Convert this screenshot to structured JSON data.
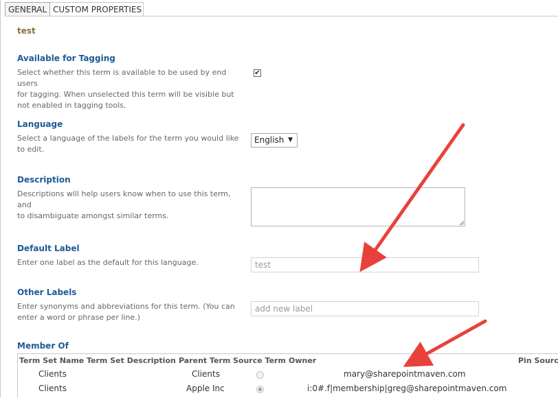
{
  "tabs": [
    {
      "label": "GENERAL"
    },
    {
      "label": "CUSTOM PROPERTIES"
    }
  ],
  "term": {
    "name": "test"
  },
  "sections": {
    "tagging": {
      "title": "Available for Tagging",
      "desc_lines": [
        "Select whether this term is available to be used by end users",
        "for tagging. When unselected this term will be visible but",
        "not enabled in tagging tools."
      ],
      "checked_glyph": "✔"
    },
    "language": {
      "title": "Language",
      "desc_lines": [
        "Select a language of the labels for the term you would like",
        "to edit."
      ],
      "selected": "English",
      "caret": "▼"
    },
    "description": {
      "title": "Description",
      "desc_lines": [
        "Descriptions will help users know when to use this term, and",
        "to disambiguate amongst similar terms."
      ],
      "value": ""
    },
    "default_label": {
      "title": "Default Label",
      "desc_lines": [
        "Enter one label as the default for this language."
      ],
      "value": "test"
    },
    "other_labels": {
      "title": "Other Labels",
      "desc_lines": [
        "Enter synonyms and abbreviations for this term. (You can",
        "enter a word or phrase per line.)"
      ],
      "placeholder": "add new label"
    },
    "member_of": {
      "title": "Member Of",
      "columns": [
        "Term Set Name",
        "Term Set Description",
        "Parent Term",
        "Source Term",
        "Owner",
        "Pin Source"
      ],
      "rows": [
        {
          "term_set_name": "Clients",
          "parent_term": "Clients",
          "source_term_selected": false,
          "owner": "mary@sharepointmaven.com"
        },
        {
          "term_set_name": "Clients",
          "parent_term": "Apple Inc",
          "source_term_selected": true,
          "owner": "i:0#.f|membership|greg@sharepointmaven.com"
        }
      ]
    }
  },
  "colors": {
    "section_title": "#1c5a96",
    "term_name": "#8a6d3b",
    "arrow": "#e8413c"
  }
}
